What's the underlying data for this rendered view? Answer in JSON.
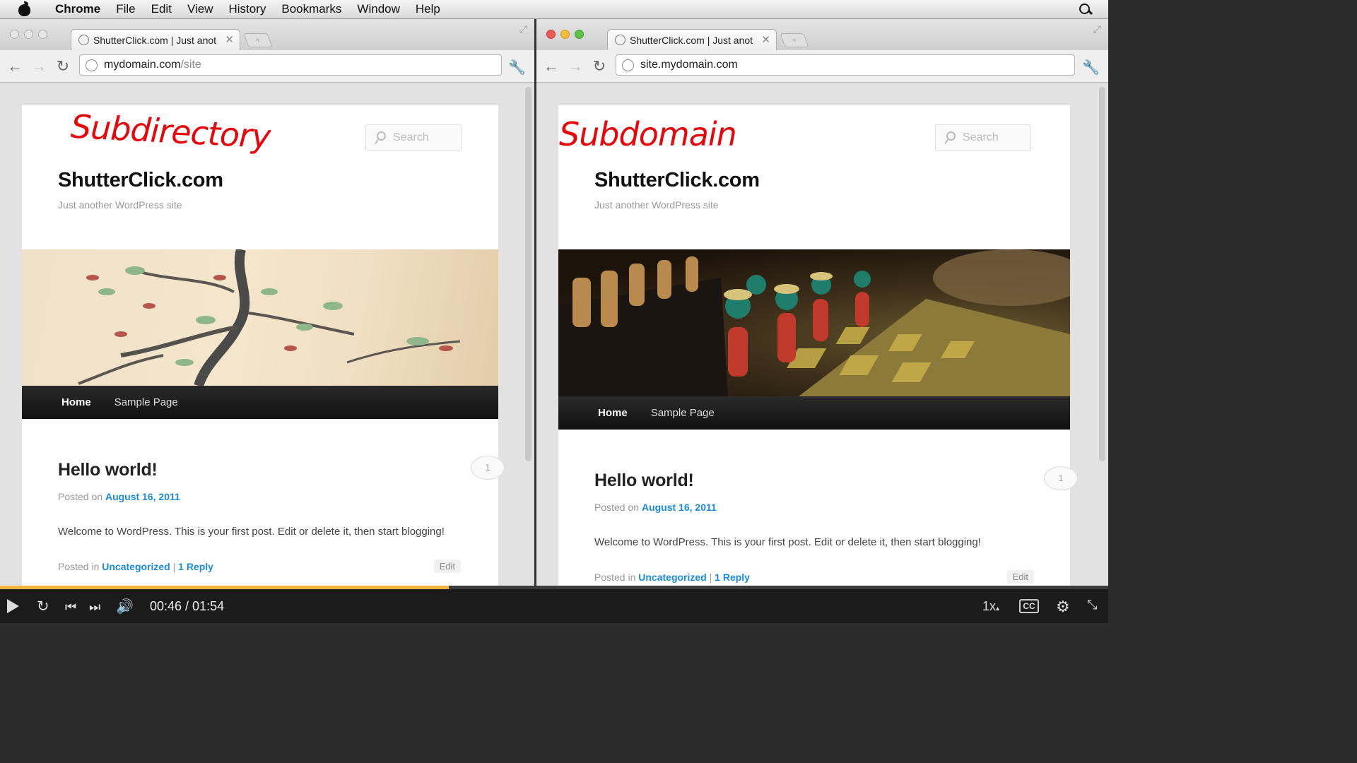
{
  "menubar": {
    "app": "Chrome",
    "items": [
      "File",
      "Edit",
      "View",
      "History",
      "Bookmarks",
      "Window",
      "Help"
    ]
  },
  "left": {
    "tab_title": "ShutterClick.com | Just anot",
    "url_host": "mydomain.com",
    "url_path": "/site",
    "annotation": "Subdirectory"
  },
  "right": {
    "tab_title": "ShutterClick.com | Just anot",
    "url_host": "site.mydomain.com",
    "url_path": "",
    "annotation": "Subdomain"
  },
  "site": {
    "title": "ShutterClick.com",
    "tagline": "Just another WordPress site",
    "search_placeholder": "Search",
    "nav": {
      "home": "Home",
      "sample": "Sample Page"
    },
    "post": {
      "title": "Hello world!",
      "posted_on": "Posted on",
      "date": "August 16, 2011",
      "body": "Welcome to WordPress. This is your first post. Edit or delete it, then start blogging!",
      "posted_in": "Posted in",
      "category": "Uncategorized",
      "sep": " | ",
      "replies": "1 Reply",
      "edit": "Edit",
      "comment_count": "1"
    }
  },
  "player": {
    "time": "00:46 / 01:54",
    "progress": 0.405,
    "speed": "1x",
    "cc": "CC",
    "progress_color": "#f1b43c"
  }
}
